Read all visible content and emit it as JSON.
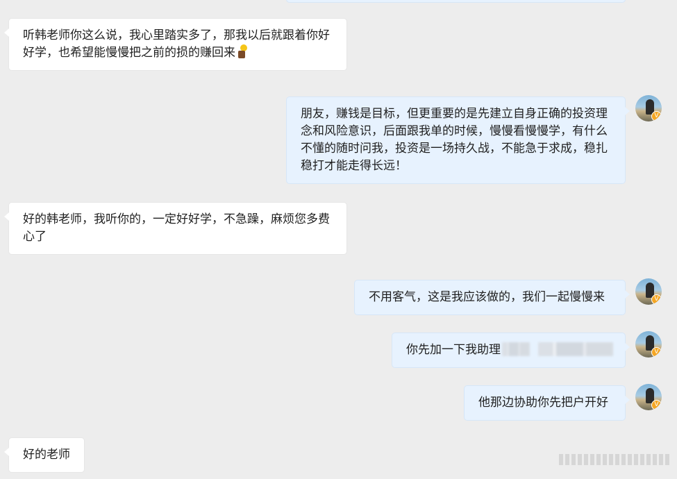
{
  "messages": [
    {
      "side": "in",
      "text": "听韩老师你这么说，我心里踏实多了，那我以后就跟着你好好学，也希望能慢慢把之前的损的赚回来",
      "emoji": "person-holding-lightbulb-emoji"
    },
    {
      "side": "out",
      "text": "朋友，赚钱是目标，但更重要的是先建立自身正确的投资理念和风险意识，后面跟我单的时候，慢慢看慢慢学，有什么不懂的随时问我，投资是一场持久战，不能急于求成，稳扎稳打才能走得长远！"
    },
    {
      "side": "in",
      "text": "好的韩老师，我听你的，一定好好学，不急躁，麻烦您多费心了"
    },
    {
      "side": "out",
      "text": "不用客气，这是我应该做的，我们一起慢慢来"
    },
    {
      "side": "out",
      "text": "你先加一下我助理",
      "redacted": true
    },
    {
      "side": "out",
      "text": "他那边协助你先把户开好"
    },
    {
      "side": "in",
      "text": "好的老师"
    }
  ],
  "avatar": {
    "icon": "user-avatar",
    "badge_icon": "verified-badge-icon",
    "badge_symbol": "V"
  },
  "colors": {
    "background": "#ededed",
    "incoming_bubble": "#ffffff",
    "outgoing_bubble": "#e7f2fe",
    "badge": "#f5a623"
  },
  "watermark": {
    "icon": "blurred-watermark"
  }
}
